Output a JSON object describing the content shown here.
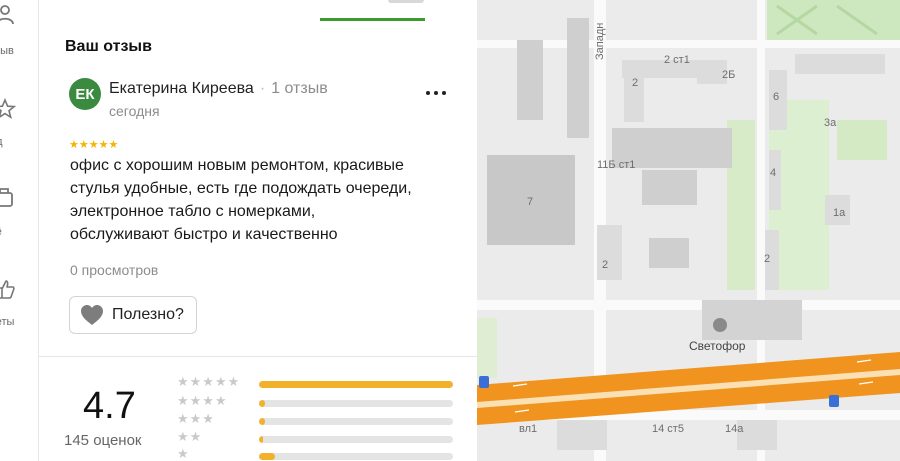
{
  "rail": {
    "items": [
      {
        "label": "тзыв",
        "icon": "person-icon"
      },
      {
        "label": "ид",
        "icon": "star-icon"
      },
      {
        "label": "ьё",
        "icon": "photo-icon"
      },
      {
        "label": "веты",
        "icon": "thumbs-up-icon"
      }
    ]
  },
  "review": {
    "section_title": "Ваш отзыв",
    "avatar_initials": "ЕК",
    "author": "Екатерина Киреева",
    "author_review_count": "1 отзыв",
    "date": "сегодня",
    "stars": "★★★★★",
    "text_lines": [
      "офис с хорошим новым ремонтом, красивые",
      "стулья удобные, есть где подождать очереди,",
      "электронное табло с номерками,",
      "обслуживают быстро и качественно"
    ],
    "views": "0 просмотров",
    "useful_label": "Полезно?"
  },
  "summary": {
    "rating": "4.7",
    "count": "145 оценок",
    "distribution": [
      {
        "stars": "★★★★★",
        "fraction": 1.0
      },
      {
        "stars": "★★★★",
        "fraction": 0.03
      },
      {
        "stars": "★★★",
        "fraction": 0.03
      },
      {
        "stars": "★★",
        "fraction": 0.02
      },
      {
        "stars": "★",
        "fraction": 0.08
      }
    ]
  },
  "map": {
    "labels": [
      "Западн",
      "2 ст1",
      "2Б",
      "2",
      "6",
      "3а",
      "11Б ст1",
      "4",
      "7",
      "1а",
      "2",
      "2",
      "Светофор",
      "вл1",
      "14 ст5",
      "14а"
    ]
  },
  "colors": {
    "accent_green": "#3c9a2e",
    "avatar": "#3a8a3f",
    "star": "#f5b400",
    "bar_fill": "#f2b12a",
    "road": "#f0931f"
  }
}
